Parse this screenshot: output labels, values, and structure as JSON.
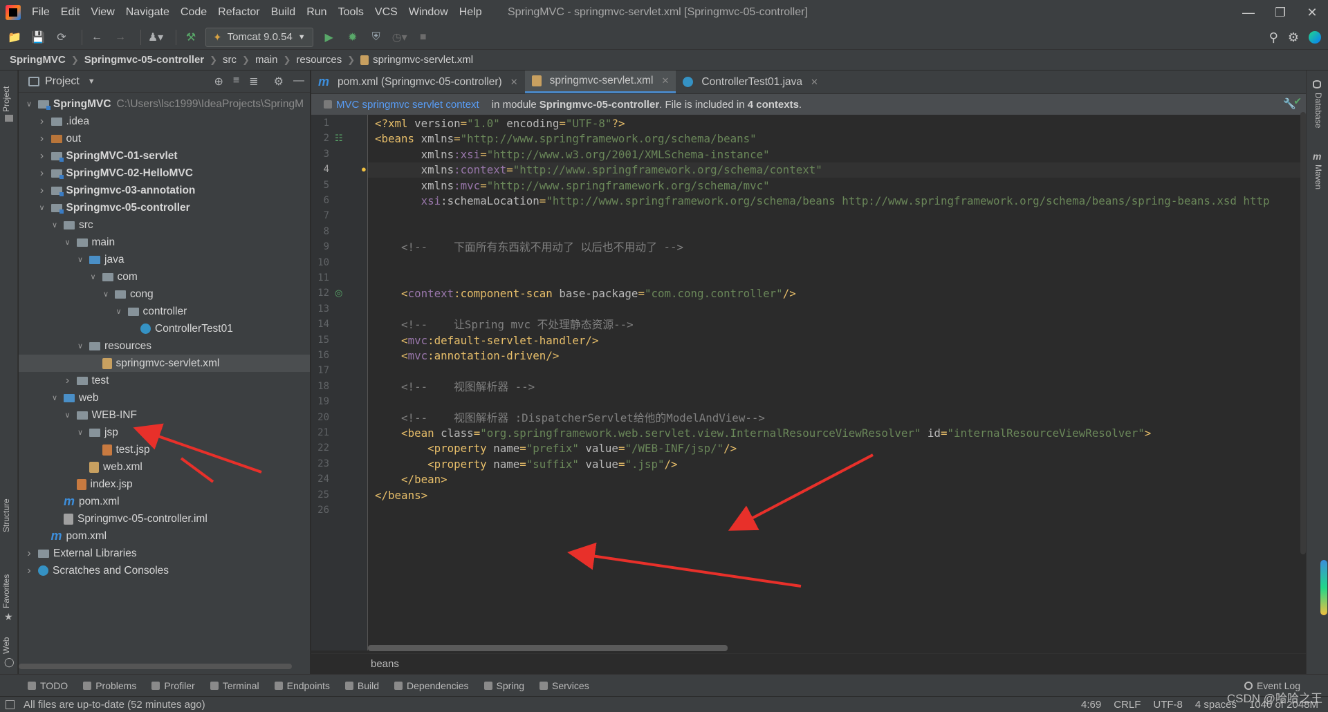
{
  "menu": {
    "items": [
      "File",
      "Edit",
      "View",
      "Navigate",
      "Code",
      "Refactor",
      "Build",
      "Run",
      "Tools",
      "VCS",
      "Window",
      "Help"
    ],
    "window_title": "SpringMVC - springmvc-servlet.xml [Springmvc-05-controller]"
  },
  "toolbar": {
    "run_config": "Tomcat 9.0.54"
  },
  "breadcrumb": [
    "SpringMVC",
    "Springmvc-05-controller",
    "src",
    "main",
    "resources",
    "springmvc-servlet.xml"
  ],
  "left_stripe": [
    "Project",
    "Structure",
    "Favorites",
    "Web"
  ],
  "right_stripe": [
    "Database",
    "Maven"
  ],
  "project": {
    "title": "Project",
    "root_path": "C:\\Users\\lsc1999\\IdeaProjects\\SpringM",
    "tree": [
      {
        "label": "SpringMVC",
        "depth": 0,
        "arrow": "down",
        "icon": "module",
        "bold": true
      },
      {
        "label": ".idea",
        "depth": 1,
        "arrow": "right",
        "icon": "folder"
      },
      {
        "label": "out",
        "depth": 1,
        "arrow": "right",
        "icon": "folder-orange"
      },
      {
        "label": "SpringMVC-01-servlet",
        "depth": 1,
        "arrow": "right",
        "icon": "module",
        "bold": true
      },
      {
        "label": "SpringMVC-02-HelloMVC",
        "depth": 1,
        "arrow": "right",
        "icon": "module",
        "bold": true
      },
      {
        "label": "Springmvc-03-annotation",
        "depth": 1,
        "arrow": "right",
        "icon": "module",
        "bold": true
      },
      {
        "label": "Springmvc-05-controller",
        "depth": 1,
        "arrow": "down",
        "icon": "module",
        "bold": true
      },
      {
        "label": "src",
        "depth": 2,
        "arrow": "down",
        "icon": "folder"
      },
      {
        "label": "main",
        "depth": 3,
        "arrow": "down",
        "icon": "folder"
      },
      {
        "label": "java",
        "depth": 4,
        "arrow": "down",
        "icon": "folder-blue"
      },
      {
        "label": "com",
        "depth": 5,
        "arrow": "down",
        "icon": "folder"
      },
      {
        "label": "cong",
        "depth": 6,
        "arrow": "down",
        "icon": "folder"
      },
      {
        "label": "controller",
        "depth": 7,
        "arrow": "down",
        "icon": "folder"
      },
      {
        "label": "ControllerTest01",
        "depth": 8,
        "arrow": "none",
        "icon": "class"
      },
      {
        "label": "resources",
        "depth": 4,
        "arrow": "down",
        "icon": "folder"
      },
      {
        "label": "springmvc-servlet.xml",
        "depth": 5,
        "arrow": "none",
        "icon": "xml",
        "selected": true
      },
      {
        "label": "test",
        "depth": 3,
        "arrow": "right",
        "icon": "folder"
      },
      {
        "label": "web",
        "depth": 2,
        "arrow": "down",
        "icon": "folder-blue"
      },
      {
        "label": "WEB-INF",
        "depth": 3,
        "arrow": "down",
        "icon": "folder"
      },
      {
        "label": "jsp",
        "depth": 4,
        "arrow": "down",
        "icon": "folder"
      },
      {
        "label": "test.jsp",
        "depth": 5,
        "arrow": "none",
        "icon": "jsp"
      },
      {
        "label": "web.xml",
        "depth": 4,
        "arrow": "none",
        "icon": "xml"
      },
      {
        "label": "index.jsp",
        "depth": 3,
        "arrow": "none",
        "icon": "jsp"
      },
      {
        "label": "pom.xml",
        "depth": 2,
        "arrow": "none",
        "icon": "maven"
      },
      {
        "label": "Springmvc-05-controller.iml",
        "depth": 2,
        "arrow": "none",
        "icon": "iml"
      },
      {
        "label": "pom.xml",
        "depth": 1,
        "arrow": "none",
        "icon": "maven"
      },
      {
        "label": "External Libraries",
        "depth": 0,
        "arrow": "right",
        "icon": "libs"
      },
      {
        "label": "Scratches and Consoles",
        "depth": 0,
        "arrow": "right",
        "icon": "scratch"
      }
    ]
  },
  "tabs": [
    {
      "label": "pom.xml (Springmvc-05-controller)",
      "icon": "maven",
      "active": false
    },
    {
      "label": "springmvc-servlet.xml",
      "icon": "xml",
      "active": true
    },
    {
      "label": "ControllerTest01.java",
      "icon": "class",
      "active": false
    }
  ],
  "context_banner": {
    "link": "MVC springmvc servlet context",
    "text_before": "in module ",
    "module": "Springmvc-05-controller",
    "text_after": ". File is included in ",
    "count": "4 contexts",
    "end": "."
  },
  "editor": {
    "current_line": 4,
    "lines": [
      [
        [
          "punc",
          "<?"
        ],
        [
          "tag",
          "xml "
        ],
        [
          "attr",
          "version"
        ],
        [
          "punc",
          "="
        ],
        [
          "str",
          "\"1.0\" "
        ],
        [
          "attr",
          "encoding"
        ],
        [
          "punc",
          "="
        ],
        [
          "str",
          "\"UTF-8\""
        ],
        [
          "punc",
          "?>"
        ]
      ],
      [
        [
          "punc",
          "<"
        ],
        [
          "tag",
          "beans "
        ],
        [
          "attr",
          "xmlns"
        ],
        [
          "punc",
          "="
        ],
        [
          "str",
          "\"http://www.springframework.org/schema/beans\""
        ]
      ],
      [
        [
          "text",
          "       "
        ],
        [
          "attr",
          "xmlns"
        ],
        [
          "ns",
          ":xsi"
        ],
        [
          "punc",
          "="
        ],
        [
          "str",
          "\"http://www.w3.org/2001/XMLSchema-instance\""
        ]
      ],
      [
        [
          "text",
          "       "
        ],
        [
          "attr",
          "xmlns"
        ],
        [
          "ns",
          ":context"
        ],
        [
          "punc",
          "="
        ],
        [
          "str",
          "\"http://www.springframework.org/schema/context\""
        ]
      ],
      [
        [
          "text",
          "       "
        ],
        [
          "attr",
          "xmlns"
        ],
        [
          "ns",
          ":mvc"
        ],
        [
          "punc",
          "="
        ],
        [
          "str",
          "\"http://www.springframework.org/schema/mvc\""
        ]
      ],
      [
        [
          "text",
          "       "
        ],
        [
          "ns",
          "xsi"
        ],
        [
          "attr",
          ":schemaLocation"
        ],
        [
          "punc",
          "="
        ],
        [
          "str",
          "\"http://www.springframework.org/schema/beans http://www.springframework.org/schema/beans/spring-beans.xsd http"
        ]
      ],
      [],
      [],
      [
        [
          "text",
          "    "
        ],
        [
          "com",
          "<!--    下面所有东西就不用动了 以后也不用动了 -->"
        ]
      ],
      [],
      [],
      [
        [
          "text",
          "    "
        ],
        [
          "punc",
          "<"
        ],
        [
          "ns",
          "context"
        ],
        [
          "tag",
          ":component-scan "
        ],
        [
          "attr",
          "base-package"
        ],
        [
          "punc",
          "="
        ],
        [
          "str",
          "\"com.cong.controller\""
        ],
        [
          "punc",
          "/>"
        ]
      ],
      [],
      [
        [
          "text",
          "    "
        ],
        [
          "com",
          "<!--    让Spring mvc 不处理静态资源-->"
        ]
      ],
      [
        [
          "text",
          "    "
        ],
        [
          "punc",
          "<"
        ],
        [
          "ns",
          "mvc"
        ],
        [
          "tag",
          ":default-servlet-handler"
        ],
        [
          "punc",
          "/>"
        ]
      ],
      [
        [
          "text",
          "    "
        ],
        [
          "punc",
          "<"
        ],
        [
          "ns",
          "mvc"
        ],
        [
          "tag",
          ":annotation-driven"
        ],
        [
          "punc",
          "/>"
        ]
      ],
      [],
      [
        [
          "text",
          "    "
        ],
        [
          "com",
          "<!--    视图解析器 -->"
        ]
      ],
      [],
      [
        [
          "text",
          "    "
        ],
        [
          "com",
          "<!--    视图解析器 :DispatcherServlet给他的ModelAndView-->"
        ]
      ],
      [
        [
          "text",
          "    "
        ],
        [
          "punc",
          "<"
        ],
        [
          "tag",
          "bean "
        ],
        [
          "attr",
          "class"
        ],
        [
          "punc",
          "="
        ],
        [
          "str",
          "\"org.springframework.web.servlet.view.InternalResourceViewResolver\" "
        ],
        [
          "attr",
          "id"
        ],
        [
          "punc",
          "="
        ],
        [
          "str",
          "\"internalResourceViewResolver\""
        ],
        [
          "punc",
          ">"
        ]
      ],
      [
        [
          "text",
          "        "
        ],
        [
          "punc",
          "<"
        ],
        [
          "tag",
          "property "
        ],
        [
          "attr",
          "name"
        ],
        [
          "punc",
          "="
        ],
        [
          "str",
          "\"prefix\" "
        ],
        [
          "attr",
          "value"
        ],
        [
          "punc",
          "="
        ],
        [
          "str",
          "\"/WEB-INF/jsp/\""
        ],
        [
          "punc",
          "/>"
        ]
      ],
      [
        [
          "text",
          "        "
        ],
        [
          "punc",
          "<"
        ],
        [
          "tag",
          "property "
        ],
        [
          "attr",
          "name"
        ],
        [
          "punc",
          "="
        ],
        [
          "str",
          "\"suffix\" "
        ],
        [
          "attr",
          "value"
        ],
        [
          "punc",
          "="
        ],
        [
          "str",
          "\".jsp\""
        ],
        [
          "punc",
          "/>"
        ]
      ],
      [
        [
          "text",
          "    "
        ],
        [
          "punc",
          "</"
        ],
        [
          "tag",
          "bean"
        ],
        [
          "punc",
          ">"
        ]
      ],
      [
        [
          "punc",
          "</"
        ],
        [
          "tag",
          "beans"
        ],
        [
          "punc",
          ">"
        ]
      ],
      []
    ],
    "footer_crumb": "beans"
  },
  "bottom_tools": [
    "TODO",
    "Problems",
    "Profiler",
    "Terminal",
    "Endpoints",
    "Build",
    "Dependencies",
    "Spring",
    "Services"
  ],
  "event_log": "Event Log",
  "status": {
    "message": "All files are up-to-date (52 minutes ago)",
    "position": "4:69",
    "line_sep": "CRLF",
    "encoding": "UTF-8",
    "indent": "4 spaces",
    "memory": "1040 of 2048M"
  },
  "watermark": "CSDN @哈哈之王",
  "colors": {
    "accent": "#4a88c7",
    "annotation_arrow": "#e8302a",
    "string": "#6a8759",
    "tag": "#e8bf6a",
    "namespace": "#9876aa"
  }
}
